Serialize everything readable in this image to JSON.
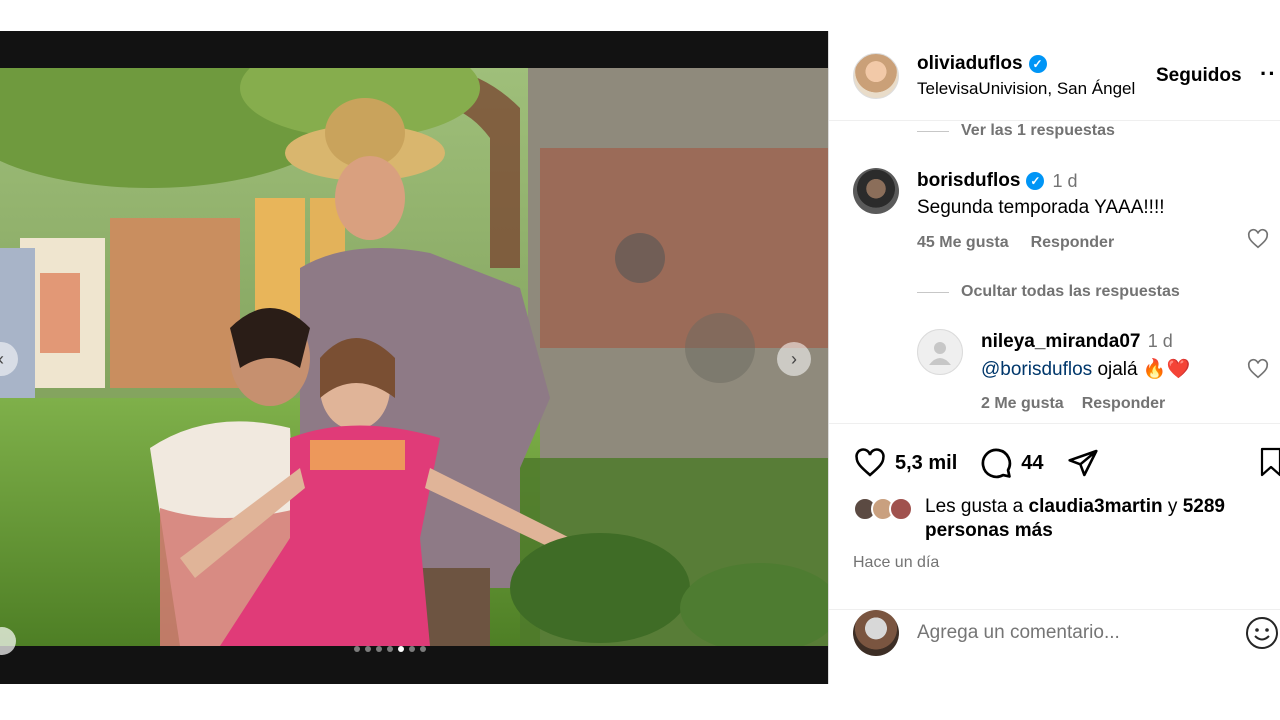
{
  "post": {
    "carousel": {
      "total": 7,
      "active_index": 4
    }
  },
  "header": {
    "username": "oliviaduflos",
    "location": "TelevisaUnivision, San Ángel",
    "follow_label": "Seguidos",
    "more_label": "··"
  },
  "comments": {
    "view_replies": "Ver las 1 respuestas",
    "hide_replies": "Ocultar todas las respuestas",
    "main": {
      "username": "borisduflos",
      "time": "1 d",
      "text": "Segunda temporada YAAA!!!!",
      "likes": "45 Me gusta",
      "reply_label": "Responder"
    },
    "reply": {
      "username": "nileya_miranda07",
      "time": "1 d",
      "mention": "@borisduflos",
      "text": " ojalá 🔥❤️",
      "likes": "2 Me gusta",
      "reply_label": "Responder"
    }
  },
  "actions": {
    "like_count": "5,3 mil",
    "comment_count": "44"
  },
  "likes": {
    "prefix": "Les gusta a ",
    "user": "claudia3martin",
    "middle": " y ",
    "others": "5289 personas más"
  },
  "posted_ago": "Hace un día",
  "add_comment": {
    "placeholder": "Agrega un comentario..."
  },
  "colors": {
    "verified": "#0095f6",
    "secondary_text": "#737373",
    "mention": "#00376b"
  }
}
